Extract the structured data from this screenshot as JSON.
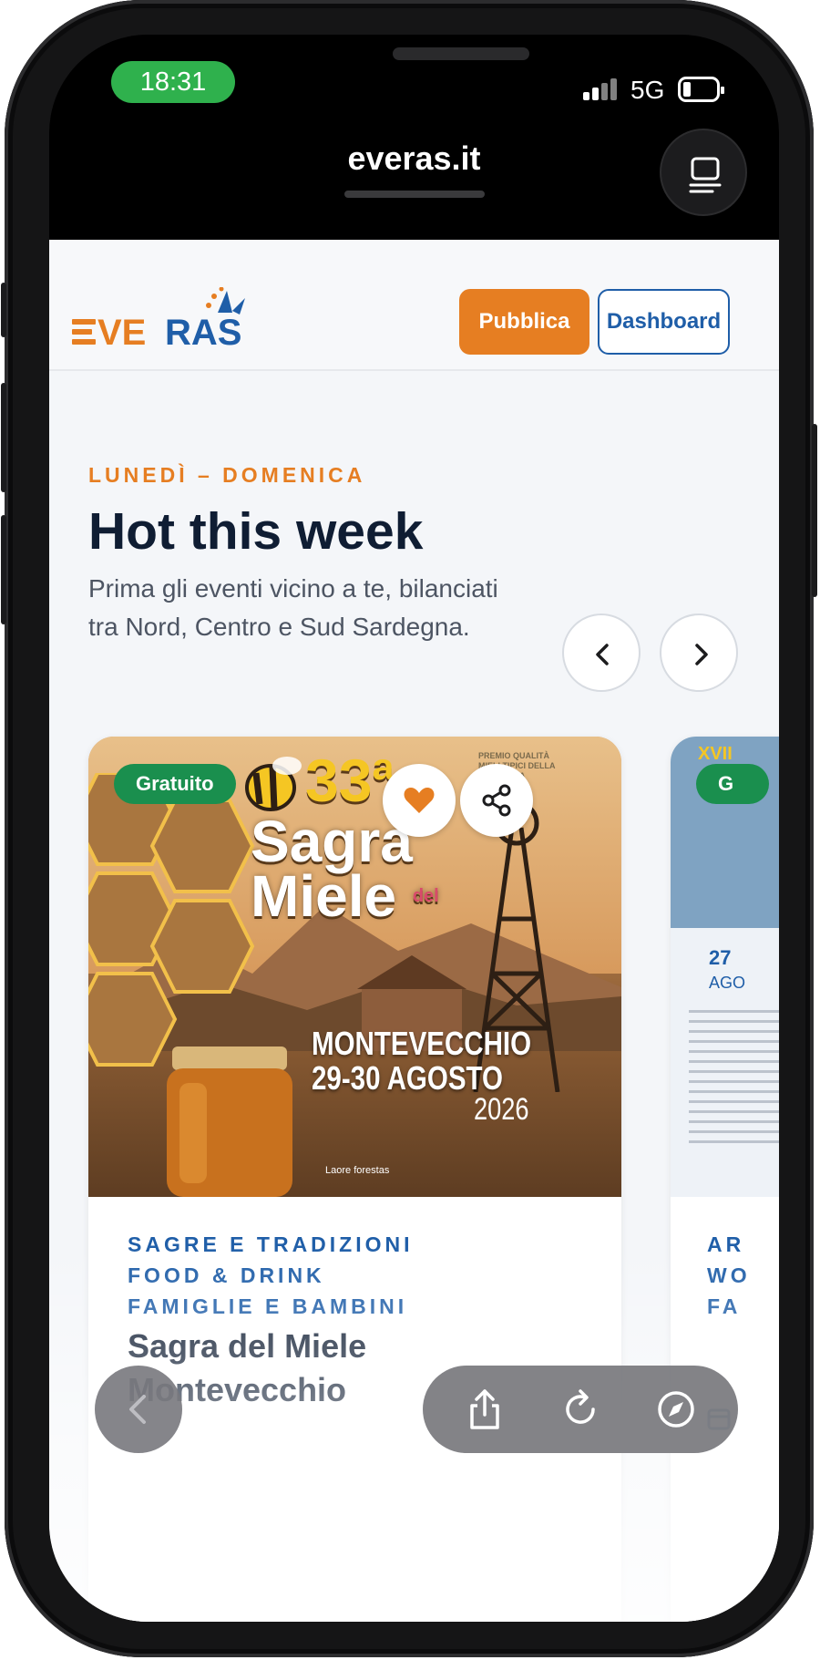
{
  "status_bar": {
    "time": "18:31",
    "network": "5G"
  },
  "browser": {
    "url": "everas.it"
  },
  "header": {
    "logo_text": "EVERAS",
    "publish_label": "Pubblica",
    "dashboard_label": "Dashboard"
  },
  "section": {
    "eyebrow": "LUNEDÌ – DOMENICA",
    "title": "Hot this week",
    "subtitle": "Prima gli eventi vicino a te, bilanciati tra Nord, Centro e Sud Sardegna."
  },
  "cards": [
    {
      "badge": "Gratuito",
      "poster": {
        "number": "33ª",
        "name_top": "Sagra",
        "name_small": "del",
        "name_bottom": "Miele",
        "premio": "PREMIO QUALITÀ MIELI TIPICI DELLA SARDEGNA",
        "place": "MONTEVECCHIO",
        "dates": "29-30 AGOSTO",
        "year": "2026",
        "sponsors": "Laore   forestas"
      },
      "categories": [
        "SAGRE E TRADIZIONI",
        "FOOD & DRINK",
        "FAMIGLIE E BAMBINI"
      ],
      "title": "Sagra del Miele Montevecchio"
    },
    {
      "badge": "G",
      "poster": {
        "header": "XVII",
        "dates": "27",
        "month": "AGO"
      },
      "categories": [
        "AR",
        "WO",
        "FA"
      ]
    }
  ],
  "icons": {
    "favorite": "heart-icon",
    "share": "share-icon",
    "prev": "chevron-left-icon",
    "next": "chevron-right-icon",
    "tabs": "tabs-icon",
    "back": "back-icon",
    "share_sheet": "share-sheet-icon",
    "reload": "reload-icon",
    "compass": "compass-icon"
  },
  "colors": {
    "accent_orange": "#e67e22",
    "brand_blue": "#1f5ea8",
    "badge_green": "#1a8f4e",
    "status_green": "#2fb14d"
  }
}
